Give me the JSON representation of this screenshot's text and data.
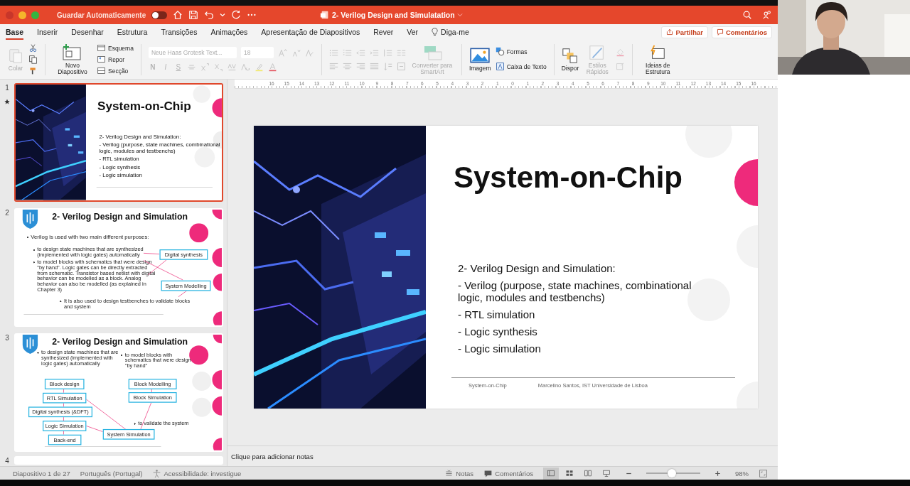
{
  "titlebar": {
    "autosave_label": "Guardar Automaticamente",
    "autosave_on": false,
    "title": "2- Verilog Design and Simulatation"
  },
  "menu_tabs": [
    {
      "label": "Base",
      "selected": true
    },
    {
      "label": "Inserir",
      "selected": false
    },
    {
      "label": "Desenhar",
      "selected": false
    },
    {
      "label": "Estrutura",
      "selected": false
    },
    {
      "label": "Transições",
      "selected": false
    },
    {
      "label": "Animações",
      "selected": false
    },
    {
      "label": "Apresentação de Diapositivos",
      "selected": false
    },
    {
      "label": "Rever",
      "selected": false
    },
    {
      "label": "Ver",
      "selected": false
    }
  ],
  "tell_me": "Diga-me",
  "share_button": "Partilhar",
  "comments_button": "Comentários",
  "ribbon": {
    "paste": {
      "label": "Colar",
      "disabled": true
    },
    "new_slide": "Novo Diapositivo",
    "layout": "Esquema",
    "reset": "Repor",
    "section": "Secção",
    "font_name": "Neue Haas Grotesk Text...",
    "font_size": "18",
    "bold": "N",
    "italic": "I",
    "underline": "S",
    "smartart": {
      "label": "Converter para SmartArt",
      "disabled": true
    },
    "picture": "Imagem",
    "shapes": "Formas",
    "text_box": "Caixa de Texto",
    "arrange": "Dispor",
    "quick_styles": {
      "label": "Estilos Rápidos",
      "disabled": true
    },
    "designer": "Ideias de Estrutura"
  },
  "thumbnails": [
    {
      "number": "1",
      "selected": true,
      "starred": true,
      "kind": "title",
      "title": "System-on-Chip",
      "lines": [
        "2- Verilog Design and Simulation:",
        "- Verilog (purpose, state machines, combinational logic, modules and testbenchs)",
        "- RTL simulation",
        "- Logic synthesis",
        "- Logic simulation"
      ]
    },
    {
      "number": "2",
      "selected": false,
      "starred": false,
      "kind": "purposes",
      "title": "2- Verilog Design and Simulation",
      "bullet": "Verilog is used with two main different purposes:",
      "sub_bullets": [
        "to design state machines that are synthesized (implemented with logic gates) automatically",
        "to model blocks with schematics that were design \"by hand\". Logic gates can be directly extracted from schematic. Transistor based netlist with digital behavior can be modelled as a block. Analog behavior can also be modelled (as explained in Chapter 3)"
      ],
      "closing_bullet": "It is also used to design testbenches to validate blocks and system",
      "boxes": [
        "Digital synthesis",
        "System Modelling"
      ]
    },
    {
      "number": "3",
      "selected": false,
      "starred": false,
      "kind": "flow",
      "title": "2- Verilog Design and Simulation",
      "left_bullet": "to design state machines that are synthesized (implemented with logic gates) automatically",
      "right_bullet": "to model blocks with schematics that were design \"by hand\"",
      "flow_boxes": [
        "Block design",
        "RTL Simulation",
        "Digital synthesis (&DFT)",
        "Logic Simulation",
        "Back-end"
      ],
      "model_boxes": [
        "Block Modelling",
        "Block Simulation"
      ],
      "system_box": "System Simulation",
      "system_bullet": "to validate the system"
    },
    {
      "number": "4",
      "selected": false,
      "starred": false,
      "kind": "partial"
    }
  ],
  "ruler_labels": [
    "16",
    "15",
    "14",
    "13",
    "12",
    "11",
    "10",
    "9",
    "8",
    "7",
    "6",
    "5",
    "4",
    "3",
    "2",
    "1",
    "0",
    "1",
    "2",
    "3",
    "4",
    "5",
    "6",
    "7",
    "8",
    "9",
    "10",
    "11",
    "12",
    "13",
    "14",
    "15",
    "16"
  ],
  "slide": {
    "title": "System-on-Chip",
    "lines": [
      "2- Verilog Design and Simulation:",
      "- Verilog (purpose, state machines, combinational logic, modules and testbenchs)",
      "- RTL simulation",
      "- Logic synthesis",
      "- Logic simulation"
    ],
    "footer_left": "System-on-Chip",
    "footer_right": "Marcelino Santos, IST Universidade de Lisboa"
  },
  "notes_placeholder": "Clique para adicionar notas",
  "status_bar": {
    "slide_info": "Diapositivo 1 de 27",
    "language": "Português (Portugal)",
    "accessibility": "Acessibilidade: investigue",
    "notes": "Notas",
    "comments": "Comentários",
    "views": [
      {
        "kind": "normal",
        "selected": true
      },
      {
        "kind": "sorter",
        "selected": false
      },
      {
        "kind": "reading",
        "selected": false
      },
      {
        "kind": "slideshow",
        "selected": false
      }
    ],
    "zoom": {
      "level": 0.48
    },
    "zoom_text": "98%"
  }
}
